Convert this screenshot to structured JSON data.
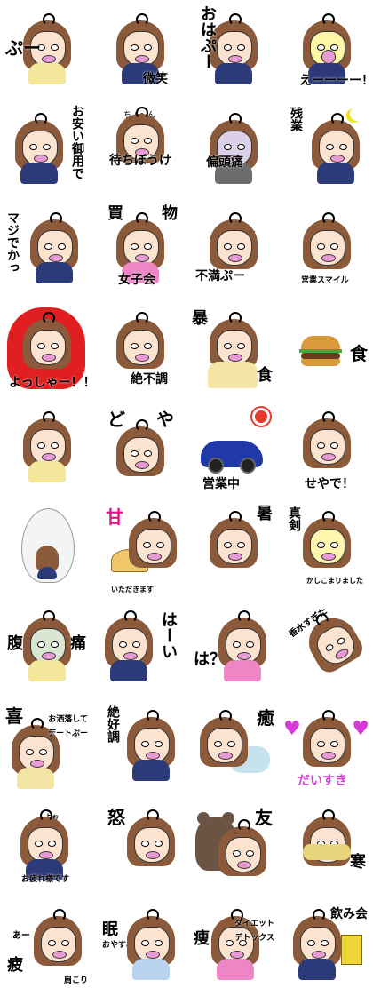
{
  "stickers": [
    {
      "id": 1,
      "texts": [
        "ぷー"
      ]
    },
    {
      "id": 2,
      "texts": [
        "微笑"
      ]
    },
    {
      "id": 3,
      "texts": [
        "おはぷー"
      ]
    },
    {
      "id": 4,
      "texts": [
        "えーーーー！！"
      ]
    },
    {
      "id": 5,
      "texts": [
        "お安い御用で"
      ]
    },
    {
      "id": 6,
      "texts": [
        "ちょ〜ん",
        "待ちぼうけ"
      ]
    },
    {
      "id": 7,
      "texts": [
        "偏頭痛"
      ]
    },
    {
      "id": 8,
      "texts": [
        "残業"
      ]
    },
    {
      "id": 9,
      "texts": [
        "マジでかっ"
      ]
    },
    {
      "id": 10,
      "texts": [
        "買",
        "物",
        "女子会"
      ]
    },
    {
      "id": 11,
      "texts": [
        "ぷー",
        "不満ぷー"
      ]
    },
    {
      "id": 12,
      "texts": [
        "営業スマイル"
      ]
    },
    {
      "id": 13,
      "texts": [
        "よっしゃー！！"
      ]
    },
    {
      "id": 14,
      "texts": [
        "絶不調"
      ]
    },
    {
      "id": 15,
      "texts": [
        "暴",
        "食"
      ]
    },
    {
      "id": 16,
      "texts": [
        "食"
      ]
    },
    {
      "id": 17,
      "texts": []
    },
    {
      "id": 18,
      "texts": [
        "ど",
        "や"
      ]
    },
    {
      "id": 19,
      "texts": [
        "営業中"
      ]
    },
    {
      "id": 20,
      "texts": [
        "せやで！"
      ]
    },
    {
      "id": 21,
      "texts": []
    },
    {
      "id": 22,
      "texts": [
        "甘",
        "いただきます"
      ]
    },
    {
      "id": 23,
      "texts": [
        "暑"
      ]
    },
    {
      "id": 24,
      "texts": [
        "真剣",
        "かしこまりました"
      ]
    },
    {
      "id": 25,
      "texts": [
        "腹",
        "痛"
      ]
    },
    {
      "id": 26,
      "texts": [
        "はーい"
      ]
    },
    {
      "id": 27,
      "texts": [
        "は？"
      ]
    },
    {
      "id": 28,
      "texts": [
        "香水すぎた"
      ]
    },
    {
      "id": 29,
      "texts": [
        "喜",
        "お洒落して",
        "デートぷー"
      ]
    },
    {
      "id": 30,
      "texts": [
        "絶好調"
      ]
    },
    {
      "id": 31,
      "texts": [
        "癒"
      ]
    },
    {
      "id": 32,
      "texts": [
        "だいすき"
      ]
    },
    {
      "id": 33,
      "texts": [
        "よぉ",
        "お疲れ様です"
      ]
    },
    {
      "id": 34,
      "texts": [
        "怒"
      ]
    },
    {
      "id": 35,
      "texts": [
        "友"
      ]
    },
    {
      "id": 36,
      "texts": [
        "寒"
      ]
    },
    {
      "id": 37,
      "texts": [
        "あー",
        "疲",
        "肩こり"
      ]
    },
    {
      "id": 38,
      "texts": [
        "眠",
        "おやすみ"
      ]
    },
    {
      "id": 39,
      "texts": [
        "痩",
        "ダイエット",
        "デトックス"
      ]
    },
    {
      "id": 40,
      "texts": [
        "飲み会"
      ]
    }
  ],
  "colors": {
    "hair": "#8a5a3a",
    "skin": "#fbe3cf",
    "lips": "#e79ad3",
    "suit": "#2d3a7a",
    "fire": "#e02020",
    "car": "#1f3aa8",
    "heart": "#d83ad8",
    "moon": "#f1e31a"
  }
}
